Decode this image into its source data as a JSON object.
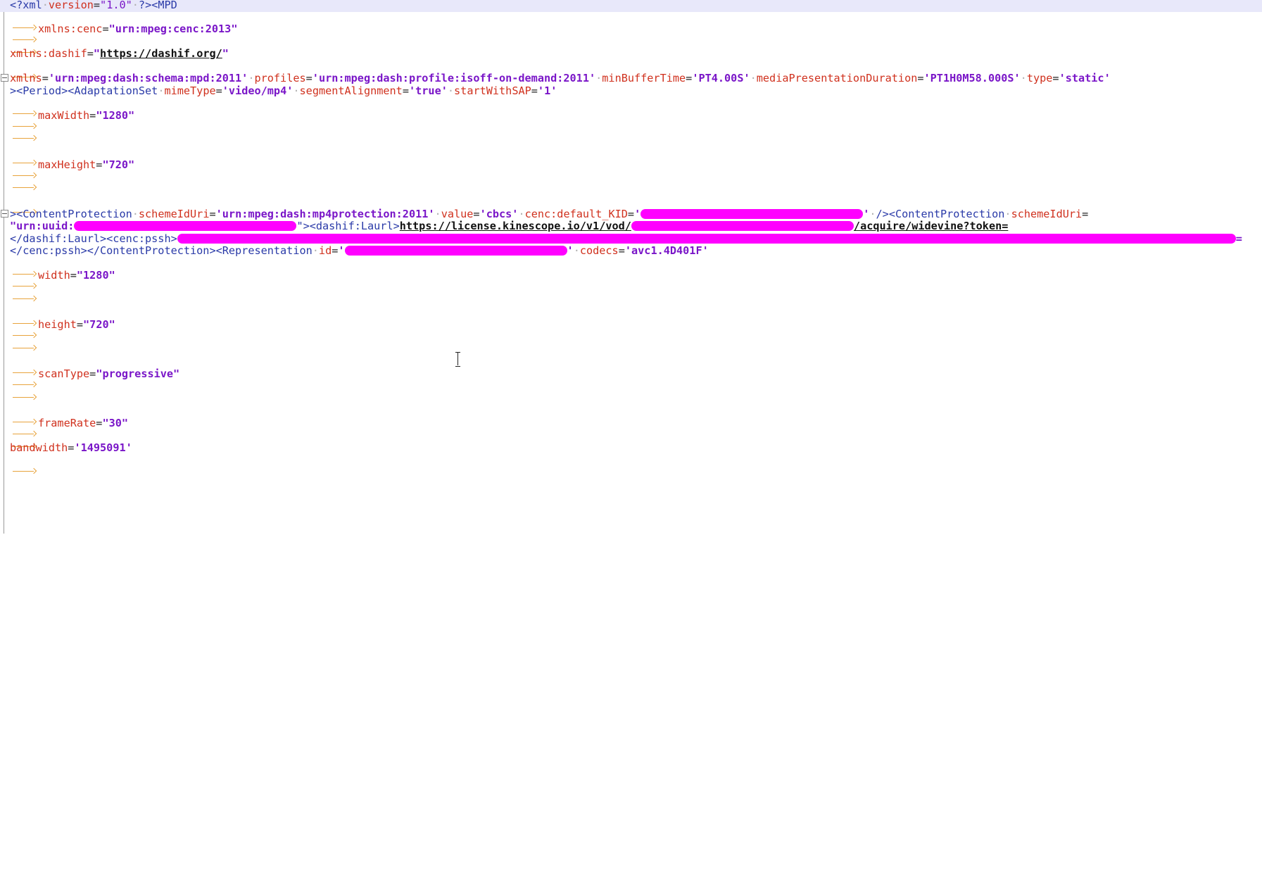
{
  "editor": {
    "line1": {
      "decl_open": "<?xml",
      "version_attr": "version",
      "version_val": "\"1.0\"",
      "decl_close": "?>",
      "mpd_tag": "<MPD"
    },
    "xmlns_cenc": {
      "attr": "xmlns:cenc",
      "val": "\"urn:mpeg:cenc:2013\""
    },
    "xmlns_dashif": {
      "attr": "xmlns:dashif",
      "q1": "\"",
      "url": "https://dashif.org/",
      "q2": "\""
    },
    "mpd_attrs": {
      "xmlns_attr": "xmlns",
      "xmlns_val": "'urn:mpeg:dash:schema:mpd:2011'",
      "profiles_attr": "profiles",
      "profiles_val": "'urn:mpeg:dash:profile:isoff-on-demand:2011'",
      "minbuf_attr": "minBufferTime",
      "minbuf_val": "'PT4.00S'",
      "dur_attr": "mediaPresentationDuration",
      "dur_val": "'PT1H0M58.000S'",
      "type_attr": "type",
      "type_val": "'static'"
    },
    "period_line": {
      "tags": "><Period><AdaptationSet",
      "mime_attr": "mimeType",
      "mime_val": "'video/mp4'",
      "seg_attr": "segmentAlignment",
      "seg_val": "'true'",
      "sap_attr": "startWithSAP",
      "sap_val": "'1'"
    },
    "max_width": {
      "attr": "maxWidth",
      "val": "\"1280\""
    },
    "max_height": {
      "attr": "maxHeight",
      "val": "\"720\""
    },
    "content_protection": {
      "tag": "><ContentProtection",
      "scheme_attr": "schemeIdUri",
      "scheme_val": "'urn:mpeg:dash:mp4protection:2011'",
      "value_attr": "value",
      "value_val": "'cbcs'",
      "kid_attr": "cenc:default_KID",
      "kid_open": "'",
      "kid_close": "'",
      "close_tag": "/><ContentProtection",
      "scheme2_attr": "schemeIdUri"
    },
    "uuid_line": {
      "uuid_prefix": "\"urn:uuid:",
      "laurl_open": "\"><dashif:Laurl>",
      "license_url": "https://license.kinescope.io/v1/vod/",
      "license_suffix": "/acquire/widevine?token="
    },
    "pssh_line": {
      "laurl_close": "</dashif:Laurl><cenc:pssh>",
      "pssh_end": "="
    },
    "representation_line": {
      "tags": "</cenc:pssh></ContentProtection><Representation",
      "id_attr": "id",
      "id_open": "'",
      "id_close": "'",
      "codecs_attr": "codecs",
      "codecs_val": "'avc1.4D401F'"
    },
    "width": {
      "attr": "width",
      "val": "\"1280\""
    },
    "height": {
      "attr": "height",
      "val": "\"720\""
    },
    "scan_type": {
      "attr": "scanType",
      "val": "\"progressive\""
    },
    "frame_rate": {
      "attr": "frameRate",
      "val": "\"30\""
    },
    "bandwidth": {
      "attr": "bandwidth",
      "val": "'1495091'"
    }
  },
  "colors": {
    "redaction": "#ff00ff",
    "attr": "#d0311e",
    "tag": "#2a3aa8",
    "value": "#7a16c8",
    "tab_arrow": "#e8a33c",
    "current_line": "#e8e8fa"
  },
  "icons": [
    "fold-marker-icon",
    "tab-arrow-icon",
    "text-cursor-icon"
  ]
}
